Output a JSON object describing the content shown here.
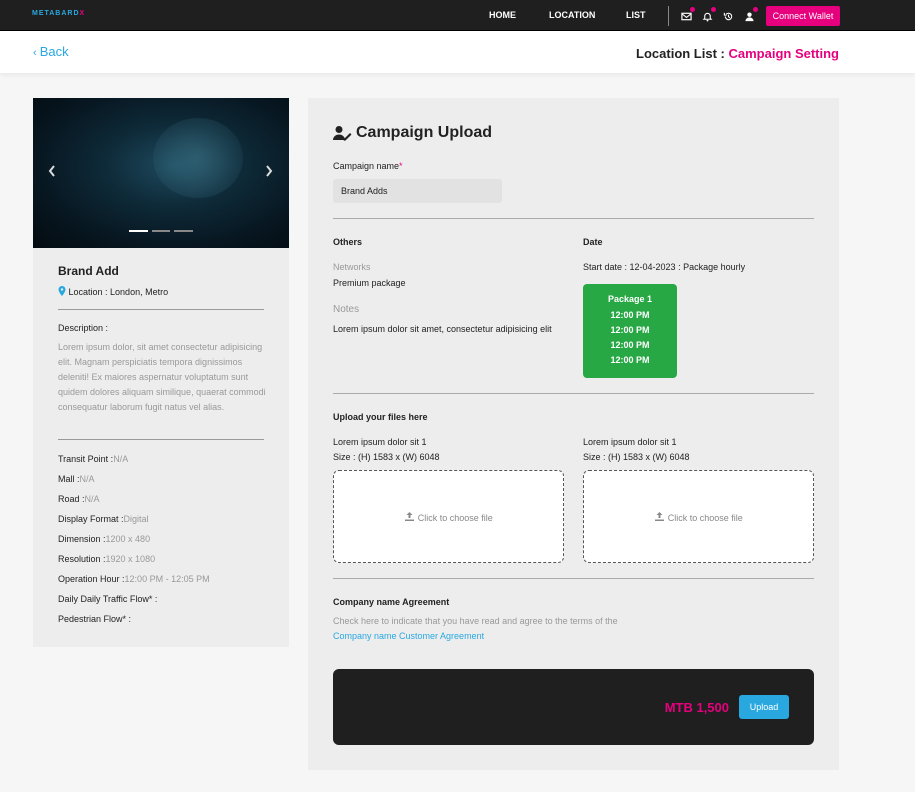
{
  "nav": {
    "logo_part1": "METAB",
    "logo_part2": "ARD",
    "logo_part3": "X",
    "links": [
      "HOME",
      "LOCATION",
      "LIST"
    ],
    "connect_label": "Connect Wallet"
  },
  "subheader": {
    "back_label": "Back",
    "breadcrumb_prefix": "Location List : ",
    "breadcrumb_current": "Campaign Setting"
  },
  "location": {
    "title": "Brand Add",
    "location_text": "Location : London, Metro",
    "description_label": "Description :",
    "description": "Lorem ipsum dolor, sit amet consectetur adipisicing elit. Magnam perspiciatis tempora dignissimos deleniti! Ex maiores aspernatur voluptatum sunt quidem dolores aliquam similique, quaerat commodi consequatur laborum fugit natus vel alias.",
    "specs": [
      {
        "label": "Transit Point :",
        "value": "N/A"
      },
      {
        "label": "Mall :",
        "value": "N/A"
      },
      {
        "label": "Road :",
        "value": "N/A"
      },
      {
        "label": "Display Format :",
        "value": "Digital"
      },
      {
        "label": "Dimension :",
        "value": "1200 x 480"
      },
      {
        "label": "Resolution :",
        "value": "1920 x 1080"
      },
      {
        "label": "Operation Hour :",
        "value": "12:00 PM - 12:05 PM"
      },
      {
        "label": "Daily Daily Traffic Flow* :",
        "value": ""
      },
      {
        "label": "Pedestrian Flow* :",
        "value": ""
      }
    ]
  },
  "campaign": {
    "title": "Campaign Upload",
    "name_label": "Campaign name",
    "name_required": "*",
    "name_value": "Brand Adds",
    "others_label": "Others",
    "networks_label": "Networks",
    "networks_value": "Premium package",
    "notes_label": "Notes",
    "notes_value": "Lorem ipsum dolor sit amet, consectetur adipisicing elit",
    "date_label": "Date",
    "date_value": "Start date : 12-04-2023 : Package hourly",
    "package": {
      "title": "Package 1",
      "slots": [
        "12:00 PM",
        "12:00 PM",
        "12:00 PM",
        "12:00 PM"
      ]
    },
    "upload_section_label": "Upload your files here",
    "files": [
      {
        "title": "Lorem ipsum dolor sit 1",
        "size": "Size : (H) 1583 x (W) 6048",
        "cta": "Click to choose file"
      },
      {
        "title": "Lorem ipsum dolor sit 1",
        "size": "Size : (H) 1583 x (W) 6048",
        "cta": "Click to choose file"
      }
    ],
    "agreement_title": "Company name Agreement",
    "agreement_text": "Check here to indicate that you have read and agree to the terms of the",
    "agreement_link": "Company name Customer Agreement",
    "price": "MTB 1,500",
    "upload_label": "Upload"
  },
  "colors": {
    "accent_pink": "#e6007e",
    "accent_blue": "#29a8e0",
    "package_green": "#28a745",
    "dark": "#1f1f1f"
  }
}
